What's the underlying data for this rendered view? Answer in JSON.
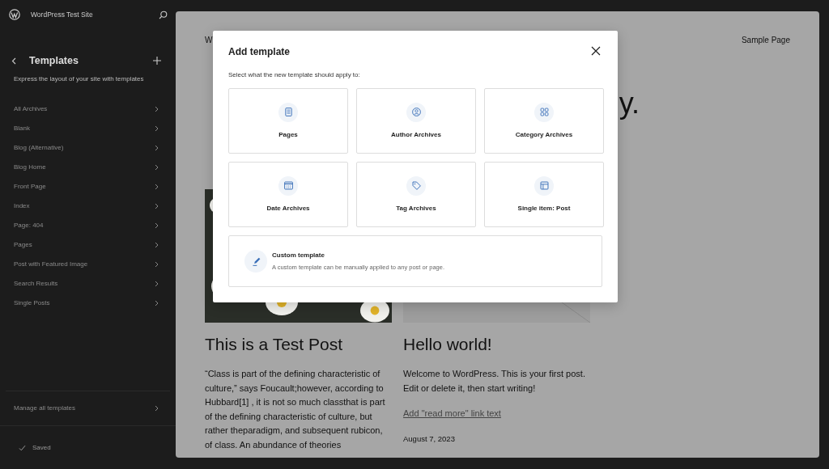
{
  "sidebar": {
    "site_title": "WordPress Test Site",
    "heading": "Templates",
    "description": "Express the layout of your site with templates",
    "items": [
      {
        "label": "All Archives"
      },
      {
        "label": "Blank"
      },
      {
        "label": "Blog (Alternative)"
      },
      {
        "label": "Blog Home"
      },
      {
        "label": "Front Page"
      },
      {
        "label": "Index"
      },
      {
        "label": "Page: 404"
      },
      {
        "label": "Pages"
      },
      {
        "label": "Post with Featured Image"
      },
      {
        "label": "Search Results"
      },
      {
        "label": "Single Posts"
      }
    ],
    "footer_link": "Manage all templates",
    "status": "Saved"
  },
  "preview": {
    "nav_site_title": "W",
    "nav_link": "Sample Page",
    "heading_fragments": [
      "y."
    ],
    "posts": [
      {
        "title": "This is a Test Post",
        "excerpt": "“Class is part of the defining characteristic of culture,” says Foucault;however, according to Hubbard[1] , it is not so much classthat is part of the defining characteristic of culture, but rather theparadigm, and subsequent rubicon, of class. An abundance of theories"
      },
      {
        "image": {
          "kind": "placeholder"
        },
        "title": "Hello world!",
        "excerpt": "Welcome to WordPress. This is your first post. Edit or delete it, then start writing!",
        "read_more": "Add \"read more\" link text",
        "date": "August 7, 2023"
      }
    ]
  },
  "modal": {
    "title": "Add template",
    "subtitle": "Select what the new template should apply to:",
    "options": [
      {
        "label": "Pages"
      },
      {
        "label": "Author Archives"
      },
      {
        "label": "Category Archives"
      },
      {
        "label": "Date Archives"
      },
      {
        "label": "Tag Archives"
      },
      {
        "label": "Single item: Post"
      }
    ],
    "custom": {
      "title": "Custom template",
      "description": "A custom template can be manually applied to any post or page."
    }
  }
}
